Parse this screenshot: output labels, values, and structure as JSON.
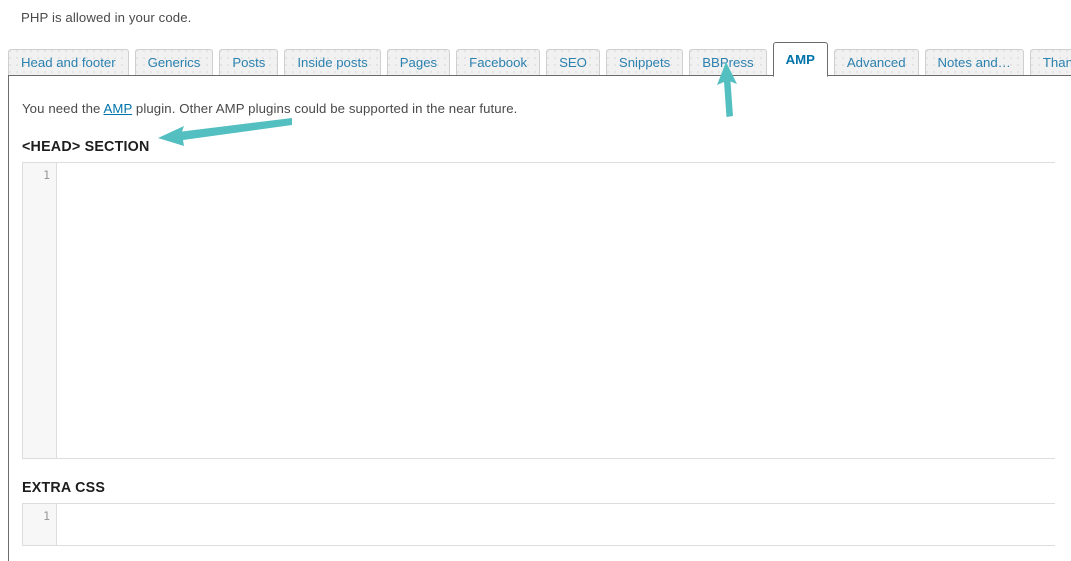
{
  "page": {
    "top_notice": "PHP is allowed in your code."
  },
  "tabs": {
    "items": [
      {
        "label": "Head and footer",
        "active": false
      },
      {
        "label": "Generics",
        "active": false
      },
      {
        "label": "Posts",
        "active": false
      },
      {
        "label": "Inside posts",
        "active": false
      },
      {
        "label": "Pages",
        "active": false
      },
      {
        "label": "Facebook",
        "active": false
      },
      {
        "label": "SEO",
        "active": false
      },
      {
        "label": "Snippets",
        "active": false
      },
      {
        "label": "BBPress",
        "active": false
      },
      {
        "label": "AMP",
        "active": true
      },
      {
        "label": "Advanced",
        "active": false
      },
      {
        "label": "Notes and…",
        "active": false
      },
      {
        "label": "Thank you",
        "active": false
      }
    ],
    "active_label": "AMP"
  },
  "amp_panel": {
    "lead_before_link": "You need the ",
    "lead_link": "AMP",
    "lead_after_link": " plugin. Other AMP plugins could be supported in the near future.",
    "head_section": {
      "title": "<HEAD> SECTION",
      "line_number": "1",
      "code": ""
    },
    "extra_css": {
      "title": "EXTRA CSS",
      "line_number": "1",
      "code": ""
    }
  },
  "annotations": {
    "arrow_color": "#53bfc0",
    "arrow_to_amp_tab": "arrow-pointing-up-to-amp-tab",
    "arrow_to_head_section": "arrow-pointing-left-to-head-section-title"
  },
  "colors": {
    "tab_text": "#2b81af",
    "active_tab_text": "#0073aa",
    "link": "#0073aa",
    "body_text": "#4a4a4a",
    "heading": "#1d1d1d",
    "tab_bg": "#f1f1f1",
    "panel_border": "#6b6b6b",
    "editor_border": "#dddddd",
    "gutter_bg": "#f7f7f7",
    "lineno_text": "#999999",
    "annotation_teal": "#53bfc0"
  }
}
